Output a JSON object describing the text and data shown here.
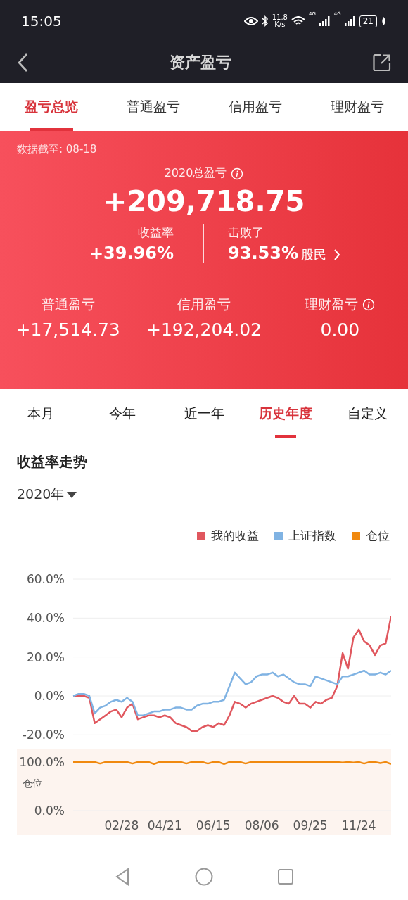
{
  "status_bar": {
    "time": "15:05",
    "net_speed": "11.8",
    "net_unit": "K/s",
    "signal_labels": [
      "4G",
      "4G"
    ],
    "battery": "21"
  },
  "header": {
    "title": "资产盈亏"
  },
  "tabs": [
    {
      "label": "盈亏总览",
      "selected": true
    },
    {
      "label": "普通盈亏",
      "selected": false
    },
    {
      "label": "信用盈亏",
      "selected": false
    },
    {
      "label": "理财盈亏",
      "selected": false
    }
  ],
  "summary": {
    "data_date": "数据截至: 08-18",
    "total_label": "2020总盈亏",
    "total_value": "+209,718.75",
    "return_label": "收益率",
    "return_value": "+39.96%",
    "beat_label": "击败了",
    "beat_value": "93.53%",
    "beat_link": "股民",
    "breakdown": [
      {
        "label": "普通盈亏",
        "value": "+17,514.73",
        "info": false
      },
      {
        "label": "信用盈亏",
        "value": "+192,204.02",
        "info": false
      },
      {
        "label": "理财盈亏",
        "value": "0.00",
        "info": true
      }
    ]
  },
  "periods": [
    {
      "label": "本月",
      "selected": false
    },
    {
      "label": "今年",
      "selected": false
    },
    {
      "label": "近一年",
      "selected": false
    },
    {
      "label": "历史年度",
      "selected": true
    },
    {
      "label": "自定义",
      "selected": false
    }
  ],
  "trend": {
    "title": "收益率走势",
    "year": "2020年",
    "chart_data": {
      "type": "line",
      "grid": true,
      "ylim": [
        -20,
        60
      ],
      "yticks": [
        {
          "value": 60,
          "label": "60.0%"
        },
        {
          "value": 40,
          "label": "40.0%"
        },
        {
          "value": 20,
          "label": "20.0%"
        },
        {
          "value": 0,
          "label": "0.0%"
        },
        {
          "value": -20,
          "label": "-20.0%"
        }
      ],
      "series": [
        {
          "name": "我的收益",
          "color": "#e0575e",
          "values": [
            0,
            0,
            0,
            -1,
            -14,
            -12,
            -10,
            -8,
            -7,
            -11,
            -6,
            -4,
            -12,
            -11,
            -10,
            -10,
            -11,
            -10,
            -11,
            -14,
            -15,
            -16,
            -18,
            -18,
            -16,
            -15,
            -16,
            -14,
            -15,
            -10,
            -3,
            -4,
            -6,
            -4,
            -3,
            -2,
            -1,
            0,
            -1,
            -3,
            -4,
            0,
            -4,
            -4,
            -6,
            -3,
            -4,
            -2,
            -1,
            5,
            22,
            14,
            30,
            34,
            28,
            26,
            21,
            26,
            27,
            41
          ]
        },
        {
          "name": "上证指数",
          "color": "#80b3e3",
          "values": [
            0,
            1,
            1,
            0,
            -9,
            -6,
            -5,
            -3,
            -2,
            -3,
            -1,
            -3,
            -10,
            -10,
            -9,
            -8,
            -8,
            -7,
            -7,
            -6,
            -6,
            -7,
            -7,
            -5,
            -4,
            -4,
            -3,
            -3,
            -2,
            5,
            12,
            9,
            6,
            7,
            10,
            11,
            11,
            12,
            10,
            11,
            9,
            7,
            6,
            6,
            5,
            10,
            9,
            8,
            7,
            6,
            10,
            10,
            11,
            12,
            13,
            11,
            11,
            12,
            11,
            13
          ]
        }
      ]
    },
    "position": {
      "chart_data": {
        "type": "line",
        "ylabel": "仓位",
        "categories": [
          null,
          null,
          null,
          null,
          null,
          null,
          null,
          null,
          null,
          "02/28",
          null,
          null,
          null,
          null,
          null,
          null,
          null,
          "04/21",
          null,
          null,
          null,
          null,
          null,
          null,
          null,
          null,
          "06/15",
          null,
          null,
          null,
          null,
          null,
          null,
          null,
          null,
          "08/06",
          null,
          null,
          null,
          null,
          null,
          null,
          null,
          null,
          "09/25",
          null,
          null,
          null,
          null,
          null,
          null,
          null,
          null,
          "11/24",
          null,
          null,
          null,
          null,
          null,
          null
        ],
        "ylim": [
          0,
          100
        ],
        "yticks": [
          {
            "value": 100,
            "label": "100.0%"
          },
          {
            "value": 0,
            "label": "0.0%"
          }
        ],
        "series": [
          {
            "name": "仓位",
            "color": "#f0890f",
            "values": [
              100,
              100,
              100,
              100,
              100,
              97,
              100,
              100,
              100,
              100,
              100,
              97,
              100,
              100,
              100,
              96,
              100,
              100,
              100,
              100,
              100,
              97,
              100,
              100,
              100,
              97,
              100,
              100,
              96,
              100,
              100,
              100,
              97,
              100,
              100,
              100,
              100,
              100,
              100,
              100,
              100,
              100,
              100,
              100,
              100,
              100,
              100,
              100,
              100,
              100,
              99,
              100,
              99,
              100,
              97,
              100,
              100,
              98,
              100,
              96
            ]
          }
        ]
      }
    }
  }
}
